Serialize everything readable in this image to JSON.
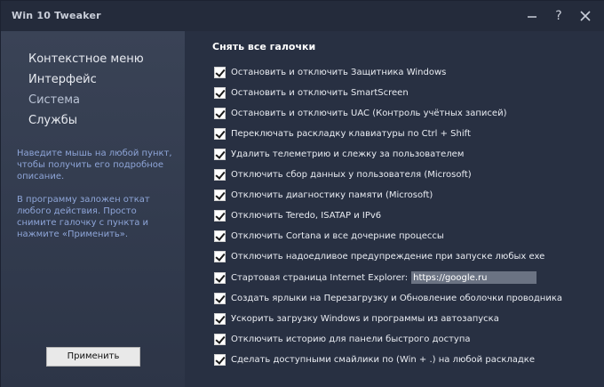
{
  "window": {
    "title": "Win 10 Tweaker",
    "controls": {
      "minimize": "─",
      "help": "?",
      "close": "✕"
    }
  },
  "sidebar": {
    "items": [
      {
        "label": "Контекстное меню",
        "active": false
      },
      {
        "label": "Интерфейс",
        "active": false
      },
      {
        "label": "Система",
        "active": true
      },
      {
        "label": "Службы",
        "active": false
      }
    ],
    "hint_1": "Наведите мышь на любой пункт, чтобы получить его подробное описание.",
    "hint_2": "В программу заложен откат любого действия. Просто снимите галочку с пункта и нажмите «Применить».",
    "apply_label": "Применить"
  },
  "main": {
    "section_title": "Снять все галочки",
    "options": [
      {
        "label": "Остановить и отключить Защитника Windows",
        "checked": true
      },
      {
        "label": "Остановить и отключить SmartScreen",
        "checked": true
      },
      {
        "label": "Остановить и отключить UAC (Контроль учётных записей)",
        "checked": true
      },
      {
        "label": "Переключать раскладку клавиатуры по Ctrl + Shift",
        "checked": true
      },
      {
        "label": "Удалить телеметрию и слежку за пользователем",
        "checked": true
      },
      {
        "label": "Отключить сбор данных у пользователя (Microsoft)",
        "checked": true
      },
      {
        "label": "Отключить диагностику памяти (Microsoft)",
        "checked": true
      },
      {
        "label": "Отключить Teredo, ISATAP и IPv6",
        "checked": true
      },
      {
        "label": "Отключить Cortana и все дочерние процессы",
        "checked": true
      },
      {
        "label": "Отключить надоедливое предупреждение при запуске любых exe",
        "checked": true
      },
      {
        "label": "Стартовая страница Internet Explorer:",
        "checked": true,
        "input_value": "https://google.ru"
      },
      {
        "label": "Создать ярлыки на Перезагрузку и Обновление оболочки проводника",
        "checked": true
      },
      {
        "label": "Ускорить загрузку Windows и программы из автозапуска",
        "checked": true
      },
      {
        "label": "Отключить историю для панели быстрого доступа",
        "checked": true
      },
      {
        "label": "Сделать доступными смайлики по (Win + .) на любой раскладке",
        "checked": true
      }
    ]
  },
  "colors": {
    "background": "#283042",
    "sidebar": "#353e51",
    "hint_text": "#8ea5d8",
    "input_bg": "#6b7383"
  }
}
